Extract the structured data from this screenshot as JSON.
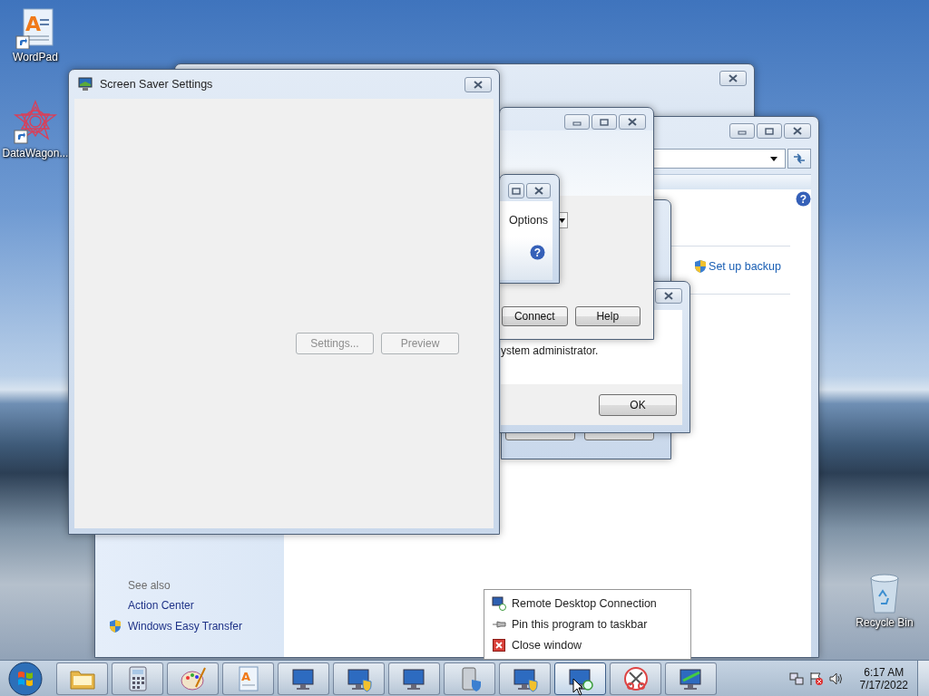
{
  "desktop_icons": [
    {
      "label": "WordPad",
      "kind": "wordpad",
      "glyph": "A"
    },
    {
      "label": "DataWagon...",
      "kind": "datawagon"
    },
    {
      "label": "Recycle Bin",
      "kind": "recycle"
    }
  ],
  "backup_window": {
    "help": "?",
    "link": "Set up backup",
    "see_also": "See also",
    "see_also_links": [
      {
        "label": "Action Center",
        "shield": false
      },
      {
        "label": "Windows Easy Transfer",
        "shield": true
      }
    ]
  },
  "remote_desktop_window": {
    "buttons": [
      "Connect",
      "Help"
    ]
  },
  "options_window": {
    "options": "Options",
    "help": "?"
  },
  "error_dialog": {
    "message": "ystem administrator.",
    "button": "OK"
  },
  "screen_saver_window": {
    "title": "Screen Saver Settings",
    "buttons": [
      {
        "label": "Settings...",
        "disabled": true
      },
      {
        "label": "Preview",
        "disabled": true
      }
    ]
  },
  "jump_list": {
    "items": [
      {
        "label": "Remote Desktop Connection",
        "kind": "program"
      },
      {
        "label": "Pin this program to taskbar",
        "kind": "pin"
      },
      {
        "label": "Close window",
        "kind": "close"
      }
    ]
  },
  "taskbar": {
    "items": [
      {
        "kind": "folder",
        "selected": false
      },
      {
        "kind": "calculator",
        "selected": false
      },
      {
        "kind": "paint",
        "selected": false
      },
      {
        "kind": "wordpad",
        "selected": false,
        "glyph": "A"
      },
      {
        "kind": "control-panel",
        "selected": false
      },
      {
        "kind": "monitor-sync",
        "selected": false
      },
      {
        "kind": "monitor-upload",
        "selected": false
      },
      {
        "kind": "drive",
        "selected": false
      },
      {
        "kind": "monitor-clock",
        "selected": false
      },
      {
        "kind": "remote-desktop",
        "selected": true
      },
      {
        "kind": "snipping",
        "selected": false
      },
      {
        "kind": "monitor-green",
        "selected": false
      }
    ],
    "time": "6:17 AM",
    "date": "7/17/2022"
  }
}
